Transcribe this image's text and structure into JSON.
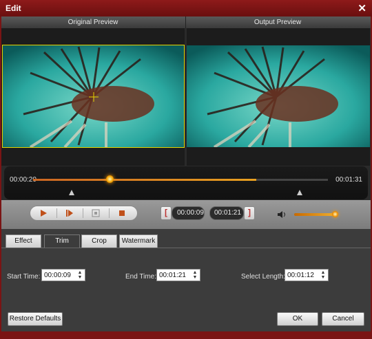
{
  "window": {
    "title": "Edit",
    "close_label": "✕"
  },
  "previews": {
    "original_label": "Original Preview",
    "output_label": "Output Preview"
  },
  "timeline": {
    "current_time": "00:00:20",
    "total_time": "00:01:31",
    "playhead_fraction": 0.22
  },
  "controls": {
    "trim_start": "00:00:09",
    "trim_end": "00:01:21",
    "volume_fraction": 0.9,
    "icons": [
      "play-icon",
      "next-frame-icon",
      "snapshot-icon",
      "stop-icon",
      "volume-icon"
    ]
  },
  "tabs": [
    {
      "label": "Effect",
      "active": false
    },
    {
      "label": "Trim",
      "active": true
    },
    {
      "label": "Crop",
      "active": false
    },
    {
      "label": "Watermark",
      "active": false
    }
  ],
  "trim_panel": {
    "start_label": "Start Time:",
    "start_value": "00:00:09",
    "end_label": "End Time:",
    "end_value": "00:01:21",
    "length_label": "Select Length:",
    "length_value": "00:01:12"
  },
  "buttons": {
    "restore": "Restore Defaults",
    "ok": "OK",
    "cancel": "Cancel"
  },
  "colors": {
    "titlebar": "#7a1414",
    "accent": "#f0a000",
    "crop_box": "#e6d400"
  }
}
